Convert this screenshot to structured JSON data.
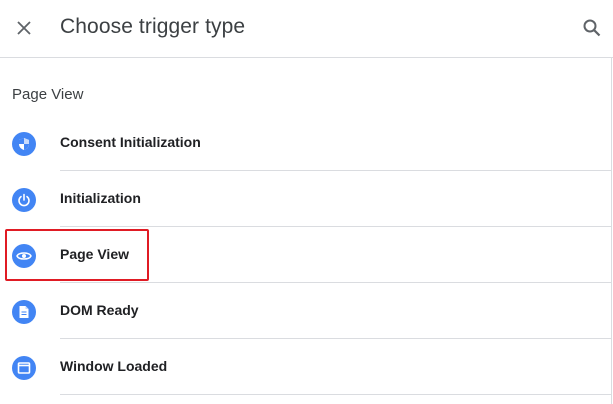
{
  "header": {
    "title": "Choose trigger type",
    "close_icon": "close-icon",
    "search_icon": "search-icon"
  },
  "section": {
    "heading": "Page View"
  },
  "items": [
    {
      "label": "Consent Initialization",
      "icon": "shield-icon"
    },
    {
      "label": "Initialization",
      "icon": "power-icon"
    },
    {
      "label": "Page View",
      "icon": "eye-icon",
      "highlighted": true
    },
    {
      "label": "DOM Ready",
      "icon": "document-icon"
    },
    {
      "label": "Window Loaded",
      "icon": "window-icon"
    }
  ],
  "colors": {
    "accent": "#4285f4",
    "highlight": "#e01b24",
    "divider": "#dadce0"
  }
}
